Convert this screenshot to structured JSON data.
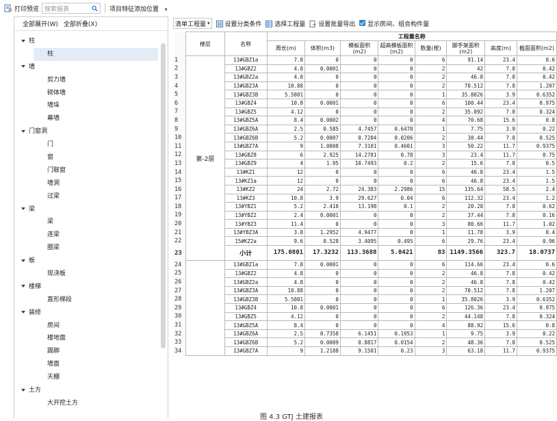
{
  "toolbar": {
    "print_preview": "打印预览",
    "search_placeholder": "搜索报表",
    "add_position": "项目特征添加位置"
  },
  "left": {
    "expand_all": "全部展开(W)",
    "collapse_all": "全部折叠(X)",
    "tree": [
      {
        "label": "柱",
        "type": "p"
      },
      {
        "label": "柱",
        "type": "sel"
      },
      {
        "label": "墙",
        "type": "p"
      },
      {
        "label": "剪力墙",
        "type": "c"
      },
      {
        "label": "砌体墙",
        "type": "c"
      },
      {
        "label": "墙垛",
        "type": "c"
      },
      {
        "label": "幕墙",
        "type": "c"
      },
      {
        "label": "门窗洞",
        "type": "p"
      },
      {
        "label": "门",
        "type": "c"
      },
      {
        "label": "窗",
        "type": "c"
      },
      {
        "label": "门联窗",
        "type": "c"
      },
      {
        "label": "墙洞",
        "type": "c"
      },
      {
        "label": "过梁",
        "type": "c"
      },
      {
        "label": "梁",
        "type": "p"
      },
      {
        "label": "梁",
        "type": "c"
      },
      {
        "label": "连梁",
        "type": "c"
      },
      {
        "label": "圈梁",
        "type": "c"
      },
      {
        "label": "板",
        "type": "p"
      },
      {
        "label": "现浇板",
        "type": "c"
      },
      {
        "label": "楼梯",
        "type": "p"
      },
      {
        "label": "直形梯段",
        "type": "c"
      },
      {
        "label": "装修",
        "type": "p"
      },
      {
        "label": "房间",
        "type": "c"
      },
      {
        "label": "楼地面",
        "type": "c"
      },
      {
        "label": "踢脚",
        "type": "c"
      },
      {
        "label": "墙面",
        "type": "c"
      },
      {
        "label": "天棚",
        "type": "c"
      },
      {
        "label": "土方",
        "type": "p"
      },
      {
        "label": "大开挖土方",
        "type": "c"
      }
    ]
  },
  "right": {
    "combo": "清单工程量",
    "set_class": "设置分类条件",
    "select_qty": "选择工程量",
    "batch_export": "设置批量导出",
    "show_rooms": "显示房间、组合构件量"
  },
  "table": {
    "group_header": "工程量名称",
    "col_floor": "楼层",
    "col_name": "名称",
    "cols": [
      "周长(m)",
      "体积(m3)",
      "模板面积(m2)",
      "超高模板面积(m2)",
      "数量(根)",
      "脚手架面积(m2)",
      "高度(m)",
      "截面面积(m2)"
    ],
    "floor_label": "第-2层",
    "rows": [
      [
        "1",
        "13#GBZ1a",
        "7.8",
        "0",
        "0",
        "0",
        "6",
        "91.14",
        "23.4",
        "0.6"
      ],
      [
        "2",
        "13#GBZ2",
        "4.8",
        "0.0001",
        "0",
        "0",
        "2",
        "42",
        "7.8",
        "0.42"
      ],
      [
        "3",
        "13#GBZ2a",
        "4.8",
        "0",
        "0",
        "0",
        "2",
        "46.8",
        "7.8",
        "0.42"
      ],
      [
        "4",
        "13#GBZ3A",
        "10.88",
        "0",
        "0",
        "0",
        "2",
        "70.512",
        "7.8",
        "1.207"
      ],
      [
        "5",
        "13#GBZ3B",
        "5.5801",
        "0",
        "0",
        "0",
        "1",
        "35.8026",
        "3.9",
        "0.6352"
      ],
      [
        "6",
        "13#GBZ4",
        "10.8",
        "0.0001",
        "0",
        "0",
        "6",
        "100.44",
        "23.4",
        "0.975"
      ],
      [
        "7",
        "13#GBZ5",
        "4.12",
        "0",
        "0",
        "0",
        "2",
        "35.092",
        "7.8",
        "0.324"
      ],
      [
        "8",
        "13#GBZ5A",
        "8.4",
        "0.0002",
        "0",
        "0",
        "4",
        "70.68",
        "15.6",
        "0.8"
      ],
      [
        "9",
        "13#GBZ6A",
        "2.5",
        "0.585",
        "4.7457",
        "0.6478",
        "1",
        "7.75",
        "3.9",
        "0.22"
      ],
      [
        "10",
        "13#GBZ6B",
        "5.2",
        "0.0007",
        "0.7204",
        "0.0206",
        "2",
        "38.44",
        "7.8",
        "0.525"
      ],
      [
        "11",
        "13#GBZ7A",
        "9",
        "1.0008",
        "7.3101",
        "0.4601",
        "3",
        "50.22",
        "11.7",
        "0.9375"
      ],
      [
        "12",
        "13#GBZ8",
        "6",
        "2.925",
        "14.2781",
        "0.78",
        "3",
        "23.4",
        "11.7",
        "0.75"
      ],
      [
        "13",
        "13#GBZ9",
        "4",
        "1.95",
        "10.7493",
        "0.2",
        "2",
        "15.6",
        "7.8",
        "0.5"
      ],
      [
        "14",
        "13#KZ1",
        "12",
        "0",
        "0",
        "0",
        "6",
        "46.8",
        "23.4",
        "1.5"
      ],
      [
        "15",
        "13#KZ1a",
        "12",
        "0",
        "0",
        "0",
        "6",
        "46.8",
        "23.4",
        "1.5"
      ],
      [
        "16",
        "13#KZ2",
        "24",
        "2.72",
        "24.383",
        "2.2986",
        "15",
        "135.64",
        "58.5",
        "2.4"
      ],
      [
        "17",
        "13#KZ3",
        "10.8",
        "3.9",
        "29.627",
        "0.04",
        "6",
        "112.32",
        "23.4",
        "1.2"
      ],
      [
        "18",
        "13#YBZ1",
        "5.2",
        "2.418",
        "13.198",
        "0.1",
        "2",
        "20.28",
        "7.8",
        "0.62"
      ],
      [
        "19",
        "13#YBZ2",
        "2.4",
        "0.0001",
        "0",
        "0",
        "2",
        "37.44",
        "7.8",
        "0.16"
      ],
      [
        "20",
        "13#YBZ3",
        "11.4",
        "0",
        "0",
        "0",
        "3",
        "80.66",
        "11.7",
        "1.02"
      ],
      [
        "21",
        "13#YBZ3A",
        "3.8",
        "1.2952",
        "4.9477",
        "0",
        "1",
        "11.78",
        "3.9",
        "0.4"
      ],
      [
        "22",
        "15#KZ2a",
        "9.6",
        "0.528",
        "3.4095",
        "0.495",
        "6",
        "29.76",
        "23.4",
        "0.96"
      ]
    ],
    "subtotal": [
      "23",
      "小计",
      "175.0801",
      "17.3232",
      "113.3688",
      "5.0421",
      "83",
      "1149.3566",
      "323.7",
      "18.0737"
    ],
    "rows2": [
      [
        "24",
        "13#GBZ1a",
        "7.8",
        "0.0001",
        "0",
        "0",
        "6",
        "114.66",
        "23.4",
        "0.6"
      ],
      [
        "25",
        "13#GBZ2",
        "4.8",
        "0",
        "0",
        "0",
        "2",
        "46.8",
        "7.8",
        "0.42"
      ],
      [
        "26",
        "13#GBZ2a",
        "4.8",
        "0",
        "0",
        "0",
        "2",
        "46.8",
        "7.8",
        "0.42"
      ],
      [
        "27",
        "13#GBZ3A",
        "10.88",
        "0",
        "0",
        "0",
        "2",
        "70.512",
        "7.8",
        "1.207"
      ],
      [
        "28",
        "13#GBZ3B",
        "5.5801",
        "0",
        "0",
        "0",
        "1",
        "35.8026",
        "3.9",
        "0.6352"
      ],
      [
        "29",
        "13#GBZ4",
        "10.8",
        "0.0001",
        "0",
        "0",
        "6",
        "126.36",
        "23.4",
        "0.975"
      ],
      [
        "30",
        "13#GBZ5",
        "4.12",
        "0",
        "0",
        "0",
        "2",
        "44.148",
        "7.8",
        "0.324"
      ],
      [
        "31",
        "13#GBZ5A",
        "8.4",
        "0",
        "0",
        "0",
        "4",
        "88.92",
        "15.6",
        "0.8"
      ],
      [
        "32",
        "13#GBZ6A",
        "2.5",
        "0.7358",
        "6.1451",
        "0.1953",
        "1",
        "9.75",
        "3.9",
        "0.22"
      ],
      [
        "33",
        "13#GBZ6B",
        "5.2",
        "0.0009",
        "0.8817",
        "0.0154",
        "2",
        "48.36",
        "7.8",
        "0.525"
      ],
      [
        "34",
        "13#GBZ7A",
        "9",
        "1.2188",
        "9.1501",
        "0.23",
        "3",
        "63.18",
        "11.7",
        "0.9375"
      ]
    ]
  },
  "caption": "图 4.3 GTJ 土建报表"
}
